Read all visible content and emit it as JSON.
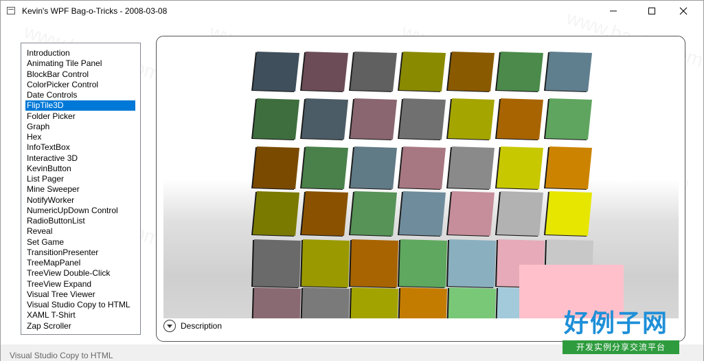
{
  "window": {
    "title": "Kevin's WPF Bag-o-Tricks - 2008-03-08",
    "controls": [
      "minimize-icon",
      "maximize-icon",
      "close-icon"
    ]
  },
  "list": {
    "selected_index": 5,
    "items": [
      "Introduction",
      "Animating Tile Panel",
      "BlockBar Control",
      "ColorPicker Control",
      "Date Controls",
      "FlipTile3D",
      "Folder Picker",
      "Graph",
      "Hex",
      "InfoTextBox",
      "Interactive 3D",
      "KevinButton",
      "List Pager",
      "Mine Sweeper",
      "NotifyWorker",
      "NumericUpDown Control",
      "RadioButtonList",
      "Reveal",
      "Set Game",
      "TransitionPresenter",
      "TreeMapPanel",
      "TreeView Double-Click",
      "TreeView Expand",
      "Visual Tree Viewer",
      "Visual Studio Copy to HTML",
      "XAML T-Shirt",
      "Zap Scroller"
    ]
  },
  "demo": {
    "description_label": "Description",
    "tile_rows": [
      [
        "#3f4f5c",
        "#6c4c57",
        "#606060",
        "#8a8a00",
        "#8a5a00",
        "#4b8a4b",
        "#5f7f8f"
      ],
      [
        "#3e6e3e",
        "#4c5c66",
        "#8a6670",
        "#707070",
        "#a5a500",
        "#a86400",
        "#5fa55f"
      ],
      [
        "#7a4a00",
        "#4a804a",
        "#607a86",
        "#a87882",
        "#8a8a8a",
        "#c8c800",
        "#cc8400"
      ],
      [
        "#7a7a00",
        "#8a5200",
        "#579257",
        "#6f8c9c",
        "#c68e9a",
        "#b2b2b2",
        "#e6e600"
      ],
      [
        "#6a6a6a",
        "#9a9a00",
        "#a86400",
        "#5fa85f",
        "#8ab0c0",
        "#e6aab8",
        "#c8c8c8"
      ],
      [
        "#8a6a72",
        "#7a7a7a",
        "#a3a300",
        "#c47c00",
        "#78c878",
        "#a3cada",
        "#ffc0cb"
      ]
    ]
  },
  "watermark": {
    "text": "www.haolizi.com",
    "logo_main": "好例子网",
    "logo_sub": "开发实例分享交流平台",
    "logo_main_color": "#1e8fd8",
    "logo_sub_bg": "#2e9c3e"
  },
  "background_window": {
    "ghost_text": "Visual Studio Copy to HTML"
  }
}
